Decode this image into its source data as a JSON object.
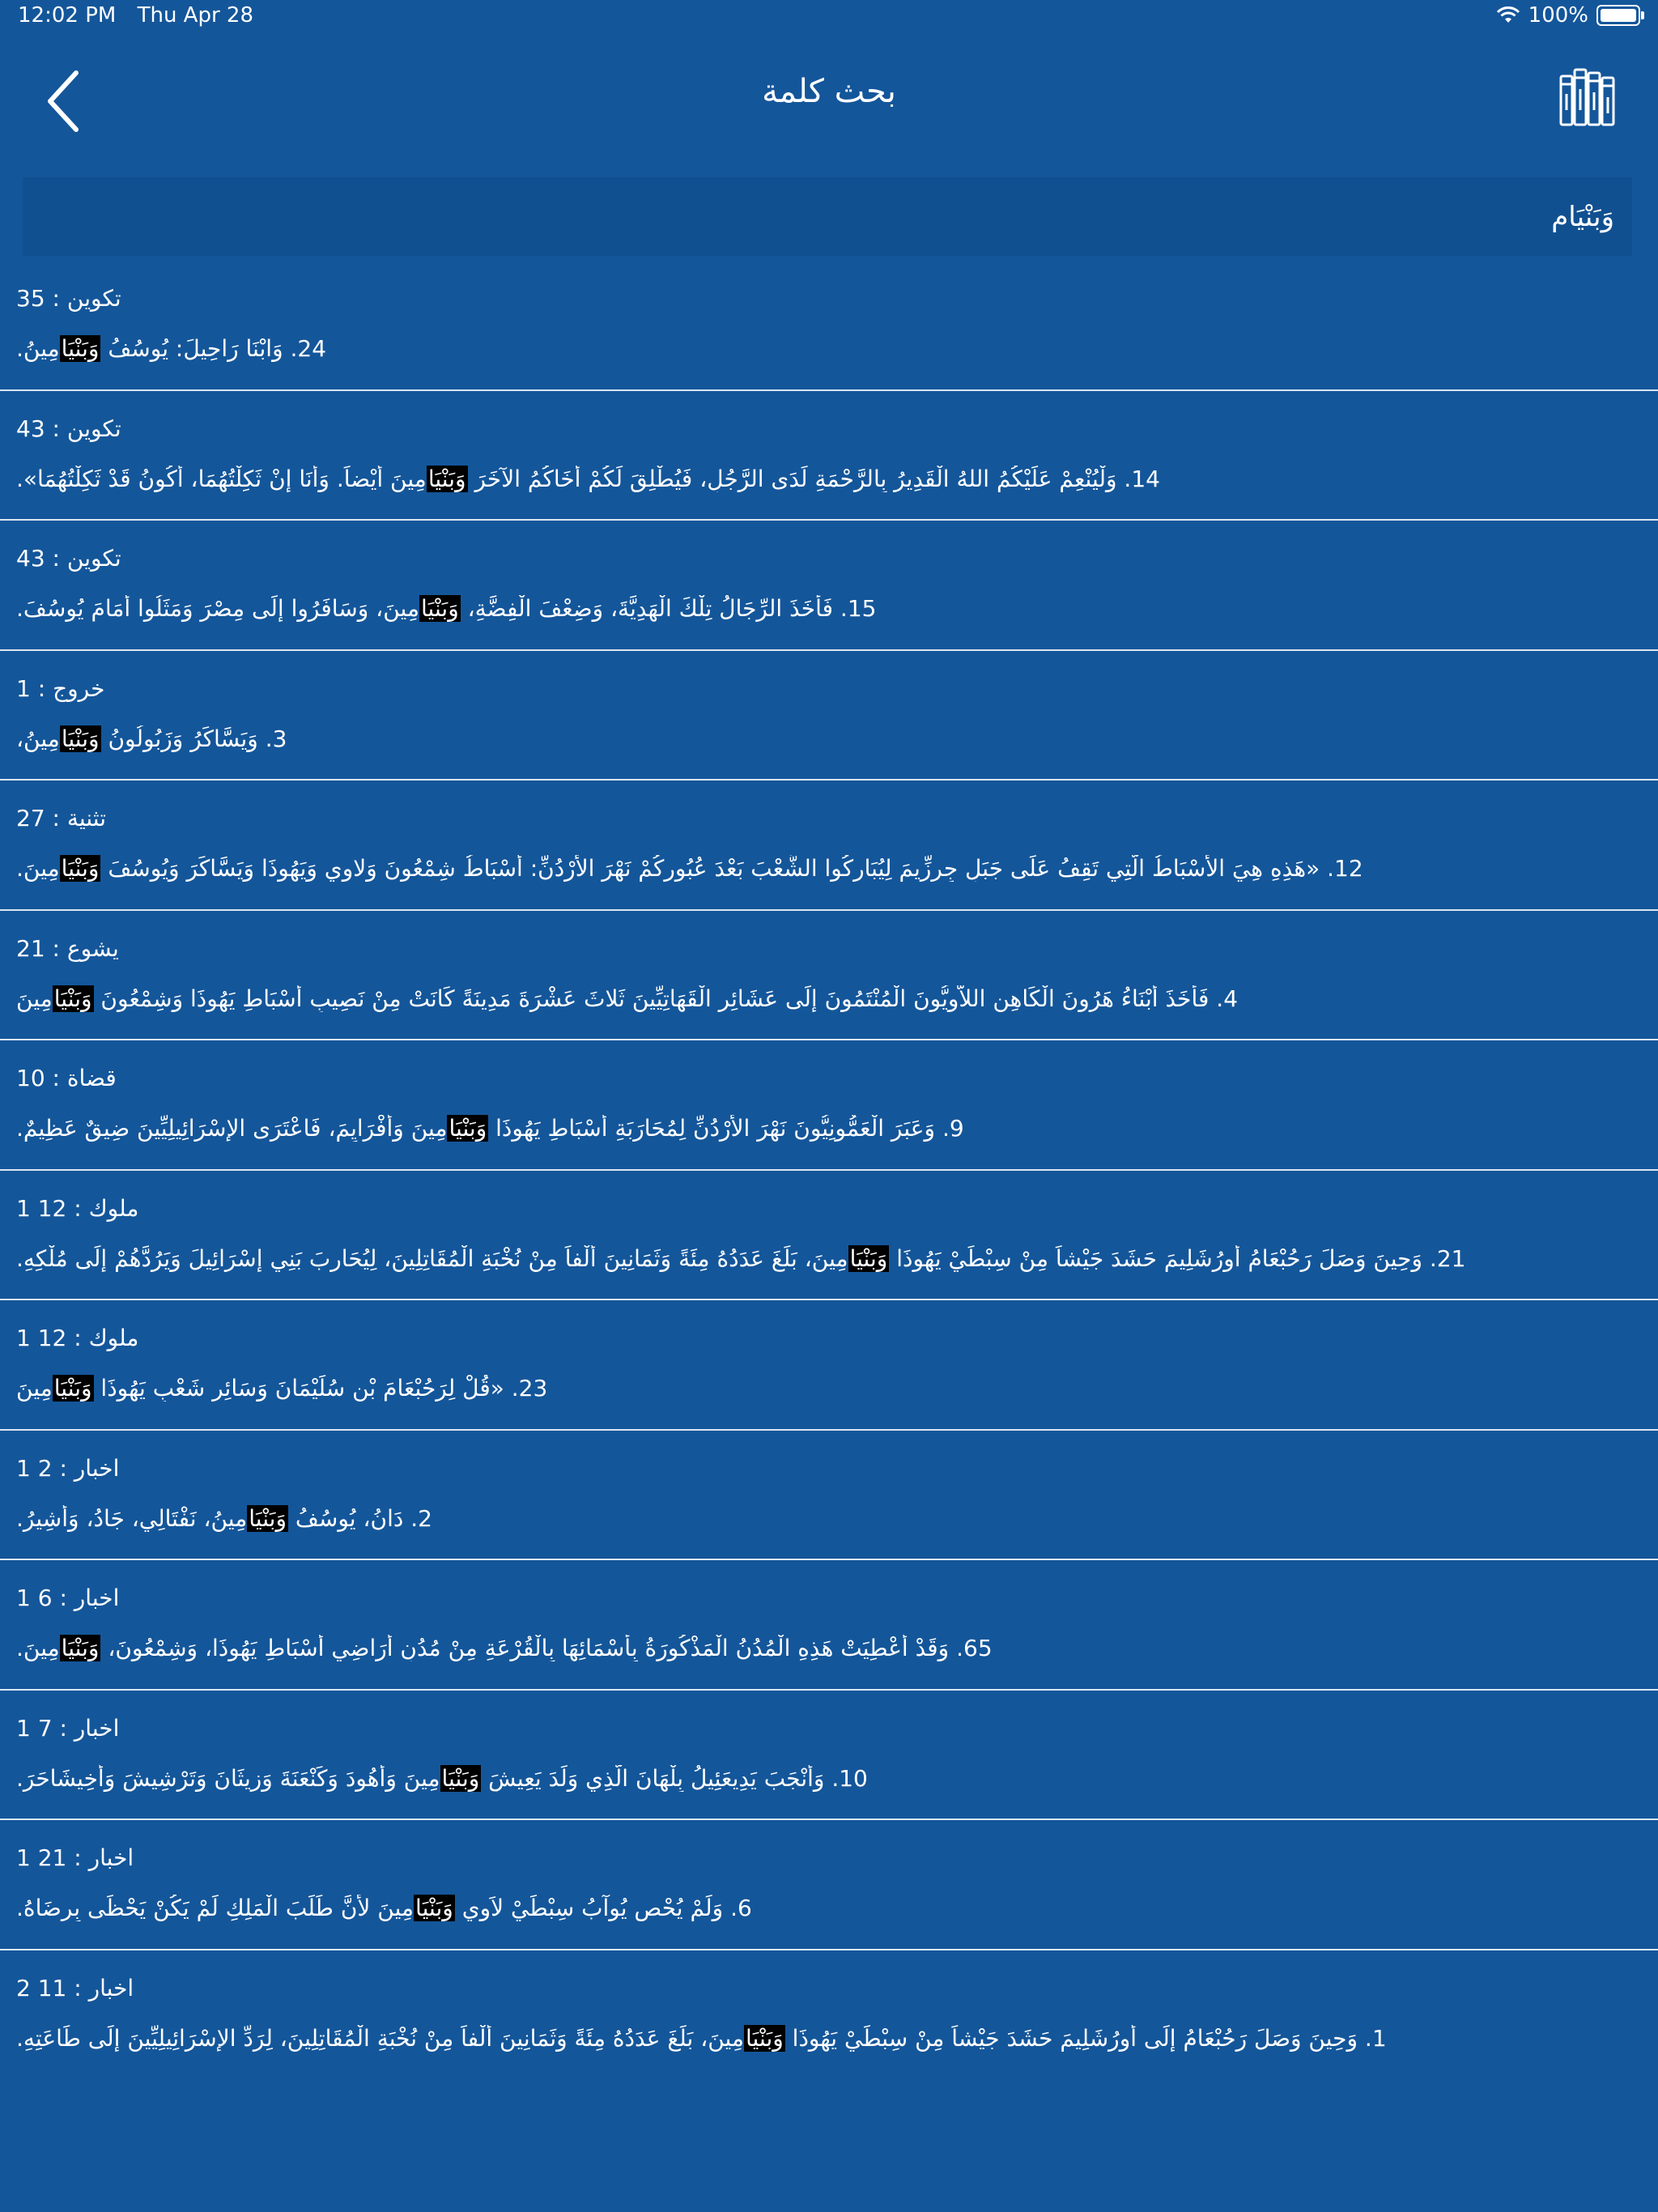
{
  "status_bar": {
    "time": "12:02 PM",
    "date": "Thu Apr 28",
    "battery": "100%",
    "battery_level": 1.0
  },
  "nav": {
    "title": "بحث كلمة",
    "back_icon": "chevron-left-icon",
    "library_icon": "books-icon"
  },
  "search": {
    "value": "وَبَنْيَام",
    "placeholder": ""
  },
  "highlight_color": "#000000",
  "results": [
    {
      "ref": "تكوين : 35",
      "number": "24.",
      "before": " وَابْنَا رَاحِيلَ: يُوسُفُ ",
      "match": "وَبَنْيَا",
      "after": "مِينُ."
    },
    {
      "ref": "تكوين : 43",
      "number": "14.",
      "before": " وَلْيُنْعِمْ عَلَيْكُمُ اللهُ الْقَدِيرُ بِالرَّحْمَةِ لَدَى الرَّجُلِ، فَيُطْلِقَ لَكُمْ أَخَاكُمُ الآخَرَ ",
      "match": "وَبَنْيَا",
      "after": "مِينَ أَيْضاً. وَأَنَا إِنْ ثَكِلْتُهُمَا، أَكُونُ قَدْ ثَكِلْتُهُمَا»."
    },
    {
      "ref": "تكوين : 43",
      "number": "15.",
      "before": " فَأَخَذَ الرِّجَالُ تِلْكَ الْهَدِيَّةَ، وَضِعْفَ الْفِضَّةِ، ",
      "match": "وَبَنْيَا",
      "after": "مِينَ، وَسَافَرُوا إِلَى مِصْرَ وَمَثَلُوا أَمَامَ يُوسُفَ."
    },
    {
      "ref": "خروج : 1",
      "number": "3.",
      "before": " وَيَسَّاكَرُ وَزَبُولُونُ ",
      "match": "وَبَنْيَا",
      "after": "مِينُ،"
    },
    {
      "ref": "تثنية : 27",
      "number": "12.",
      "before": " «هَذِهِ هِيَ الأَسْبَاطُ الَّتِي تَقِفُ عَلَى جَبَلِ جِرِزِّيمَ لِيُبَارِكُوا الشَّعْبَ بَعْدَ عُبُورِكُمْ نَهْرَ الأُرْدُنِّ: أَسْبَاطُ شِمْعُونَ وَلاوِي وَيَهُوذَا وَيَسَّاكَرَ وَيُوسُفَ ",
      "match": "وَبَنْيَا",
      "after": "مِينَ."
    },
    {
      "ref": "يشوع : 21",
      "number": "4.",
      "before": " فَأَخَذَ أَبْنَاءُ هَرُونَ الْكَاهِنِ اللاَّوِيُّونَ الْمُنْتَمُونَ إِلَى عَشَائِرِ الْقَهَاتِيِّينَ ثَلاثَ عَشْرَةَ مَدِينَةً كَانَتْ مِنْ نَصِيبِ أَسْبَاطِ يَهُوذَا وَشِمْعُونَ ",
      "match": "وَبَنْيَا",
      "after": "مِينَ"
    },
    {
      "ref": "قضاة : 10",
      "number": "9.",
      "before": " وَعَبَرَ الْعَمُّونِيُّونَ نَهْرَ الأُرْدُنِّ لِمُحَارَبَةِ أَسْبَاطِ يَهُوذَا ",
      "match": "وَبَنْيَا",
      "after": "مِينَ وَأَفْرَايِمَ، فَاعْتَرَى الإِسْرَائِيلِيِّينَ ضِيقٌ عَظِيمٌ."
    },
    {
      "ref": "1 ملوك : 12",
      "number": "21.",
      "before": " وَحِينَ وَصَلَ رَحُبْعَامُ أُورُشَلِيمَ حَشَدَ جَيْشاً مِنْ سِبْطَيْ يَهُوذَا ",
      "match": "وَبَنْيَا",
      "after": "مِينَ، بَلَغَ عَدَدُهُ مِئَةً وَثَمَانِينَ أَلْفاً مِنْ نُخْبَةِ الْمُقَاتِلِينَ، لِيُحَارِبَ بَنِي إِسْرَائِيلَ وَيَرُدَّهُمْ إِلَى مُلْكِهِ."
    },
    {
      "ref": "1 ملوك : 12",
      "number": "23.",
      "before": " «قُلْ لِرَحُبْعَامَ بْنِ سُلَيْمَانَ وَسَائِرِ شَعْبِ يَهُوذَا ",
      "match": "وَبَنْيَا",
      "after": "مِينَ"
    },
    {
      "ref": "1 اخبار : 2",
      "number": "2.",
      "before": " دَانُ، يُوسُفُ ",
      "match": "وَبَنْيَا",
      "after": "مِينُ، نَفْتَالِي، جَادُ، وَأَشِيرُ."
    },
    {
      "ref": "1 اخبار : 6",
      "number": "65.",
      "before": " وَقَدْ أُعْطِيَتْ هَذِهِ الْمُدُنُ الْمَذْكُورَةُ بِأَسْمَائِهَا بِالْقُرْعَةِ مِنْ مُدُنِ أَرَاضِي أَسْبَاطِ يَهُوذَا، وَشِمْعُونَ، ",
      "match": "وَبَنْيَا",
      "after": "مِينَ."
    },
    {
      "ref": "1 اخبار : 7",
      "number": "10.",
      "before": " وَأَنْجَبَ يَدِيعَئِيلُ بِلْهَانَ الَّذِي وَلَدَ يَعِيشَ ",
      "match": "وَبَنْيَا",
      "after": "مِينَ وَأَهُودَ وَكَنْعَنَةَ وَزِيثَانَ وَتَرْشِيشَ وَأَخِيشَاحَرَ."
    },
    {
      "ref": "1 اخبار : 21",
      "number": "6.",
      "before": " وَلَمْ يُحْصِ يُوآبُ سِبْطَيْ لاَوِي ",
      "match": "وَبَنْيَا",
      "after": "مِينَ لأَنَّ طَلَبَ الْمَلِكِ لَمْ يَكُنْ يَحْظَى بِرِضَاهُ."
    },
    {
      "ref": "2 اخبار : 11",
      "number": "1.",
      "before": " وَحِينَ وَصَلَ رَحُبْعَامُ إِلَى أُورُشَلِيمَ حَشَدَ جَيْشاً مِنْ سِبْطَيْ يَهُوذَا ",
      "match": "وَبَنْيَا",
      "after": "مِينَ، بَلَغَ عَدَدُهُ مِئَةً وَثَمَانِينَ أَلْفاً مِنْ نُخْبَةِ الْمُقَاتِلِينَ، لِرَدِّ الإِسْرَائِيلِيِّينَ إِلَى طَاعَتِهِ."
    }
  ]
}
